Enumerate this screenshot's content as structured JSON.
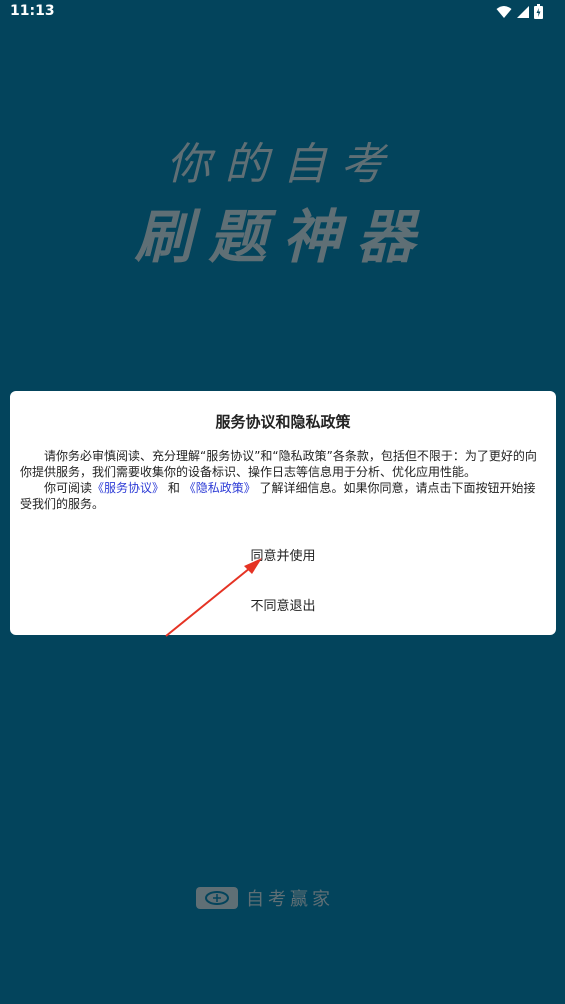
{
  "status_bar": {
    "time": "11:13",
    "icons": [
      "wifi-icon",
      "signal-icon",
      "battery-icon"
    ]
  },
  "splash": {
    "line1": "你的自考",
    "line2": "刷题神器"
  },
  "dialog": {
    "title": "服务协议和隐私政策",
    "paragraph1": "请你务必审慎阅读、充分理解“服务协议”和“隐私政策”各条款，包括但不限于：为了更好的向你提供服务，我们需要收集你的设备标识、操作日志等信息用于分析、优化应用性能。",
    "p2_prefix": "你可阅读",
    "service_link": "《服务协议》",
    "p2_and": "和",
    "privacy_link": "《隐私政策》",
    "p2_suffix": "了解详细信息。如果你同意，请点击下面按钮开始接受我们的服务。",
    "agree_button": "同意并使用",
    "disagree_button": "不同意退出"
  },
  "footer": {
    "logo_text": "自考赢家"
  },
  "colors": {
    "background": "#03445c",
    "link": "#2d3bd6",
    "arrow": "#e53324"
  }
}
